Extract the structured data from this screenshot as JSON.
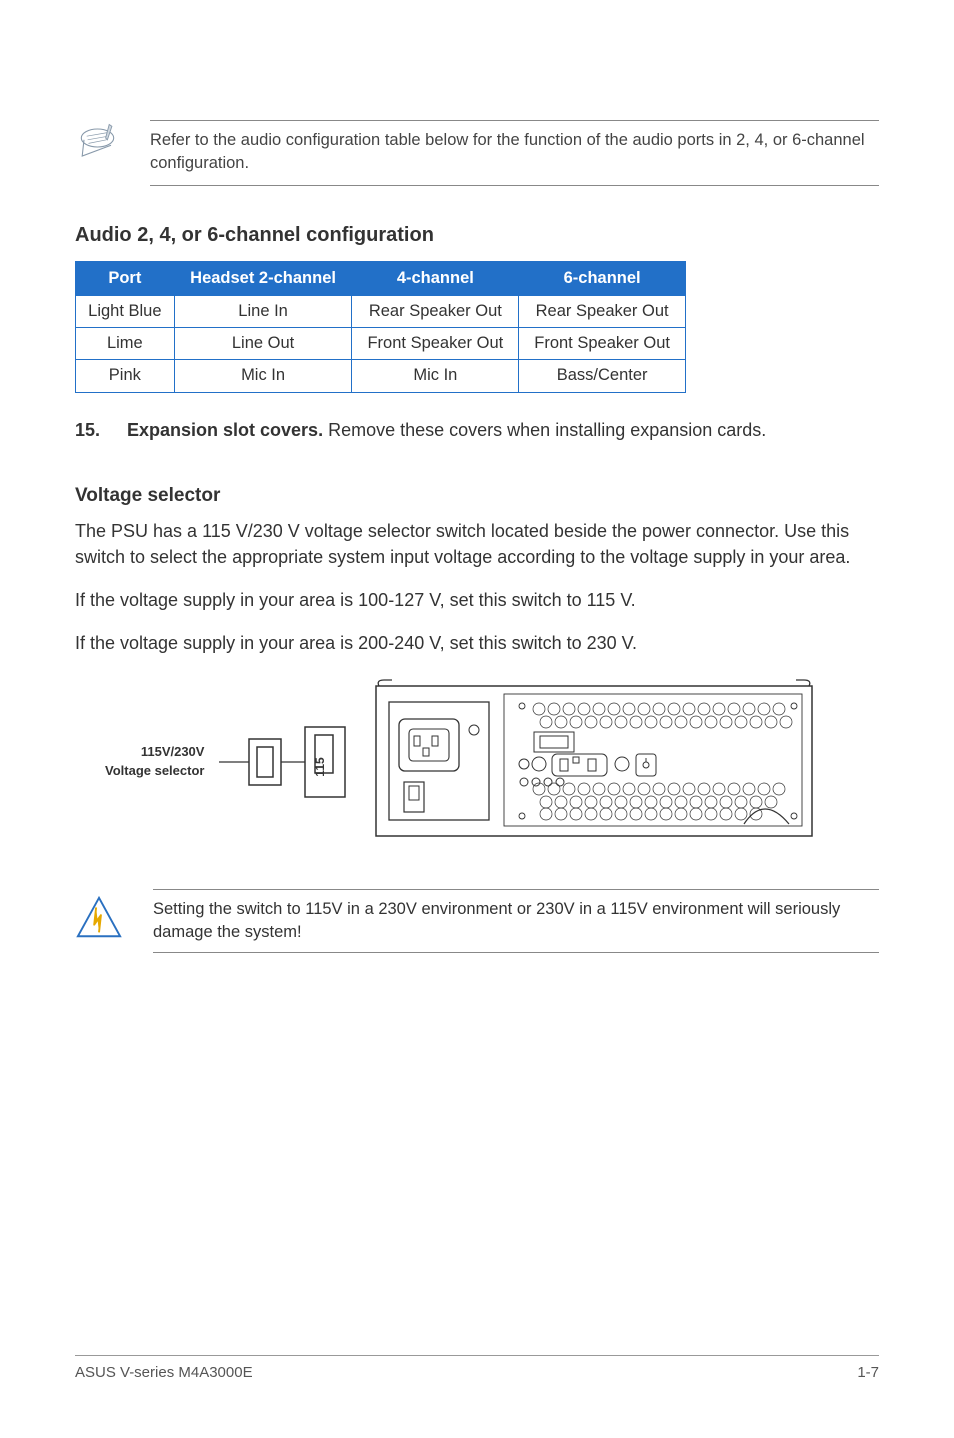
{
  "note": {
    "text": "Refer to the audio configuration table below for the function of the audio ports in 2, 4, or 6-channel configuration."
  },
  "audio_section": {
    "heading": "Audio 2, 4, or 6-channel configuration",
    "headers": {
      "c0": "Port",
      "c1": "Headset 2-channel",
      "c2": "4-channel",
      "c3": "6-channel"
    },
    "rows": [
      {
        "c0": "Light Blue",
        "c1": "Line In",
        "c2": "Rear Speaker Out",
        "c3": "Rear Speaker Out"
      },
      {
        "c0": "Lime",
        "c1": "Line Out",
        "c2": "Front Speaker Out",
        "c3": "Front Speaker Out"
      },
      {
        "c0": "Pink",
        "c1": "Mic In",
        "c2": "Mic In",
        "c3": "Bass/Center"
      }
    ]
  },
  "item15": {
    "number": "15.",
    "title": "Expansion slot covers.",
    "desc": " Remove these covers when installing expansion cards."
  },
  "voltage": {
    "heading": "Voltage selector",
    "para1": "The PSU has a 115 V/230 V voltage selector switch located beside the power connector. Use this switch to select the appropriate system input voltage according to the voltage supply in your area.",
    "para2": "If the voltage supply in your area is 100-127 V, set this switch to 115 V.",
    "para3": "If the voltage supply in your area is 200-240 V, set this switch to 230 V.",
    "label_line1": "115V/230V",
    "label_line2": "Voltage selector",
    "switch_value": "115"
  },
  "warning": {
    "text": "Setting the switch to 115V in a 230V environment or 230V in a 115V environment will seriously damage the system!"
  },
  "footer": {
    "left": "ASUS V-series M4A3000E",
    "right": "1-7"
  }
}
